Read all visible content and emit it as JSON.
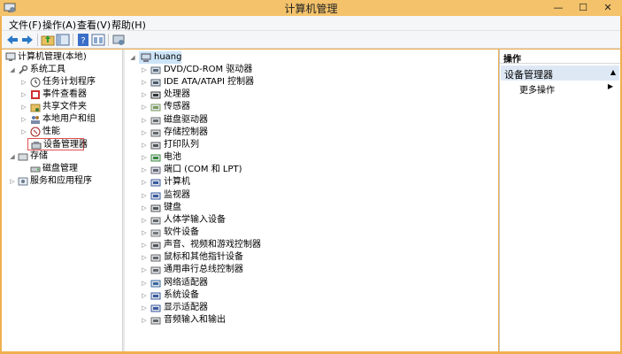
{
  "window": {
    "title": "计算机管理",
    "minimize_glyph": "—",
    "maximize_glyph": "☐",
    "close_glyph": "✕",
    "titlebar_color": "#f3c26a"
  },
  "menu": {
    "items": [
      "文件(F)",
      "操作(A)",
      "查看(V)",
      "帮助(H)"
    ]
  },
  "toolbar": {
    "buttons": [
      "back-icon",
      "forward-icon",
      "up-folder-icon",
      "show-hide-tree-icon",
      "help-icon",
      "properties-icon",
      "device-scan-icon"
    ]
  },
  "left_tree": {
    "items": [
      {
        "label": "计算机管理(本地)",
        "icon": "computer-management-icon",
        "arrow": ""
      },
      {
        "label": "系统工具",
        "icon": "tools-icon",
        "arrow": "◢"
      },
      {
        "label": "任务计划程序",
        "icon": "clock-icon",
        "arrow": "▷"
      },
      {
        "label": "事件查看器",
        "icon": "event-viewer-icon",
        "arrow": "▷"
      },
      {
        "label": "共享文件夹",
        "icon": "shared-folder-icon",
        "arrow": "▷"
      },
      {
        "label": "本地用户和组",
        "icon": "users-icon",
        "arrow": "▷"
      },
      {
        "label": "性能",
        "icon": "performance-icon",
        "arrow": "▷"
      },
      {
        "label": "设备管理器",
        "icon": "device-manager-icon",
        "arrow": ""
      },
      {
        "label": "存储",
        "icon": "storage-icon",
        "arrow": "◢"
      },
      {
        "label": "磁盘管理",
        "icon": "disk-management-icon",
        "arrow": ""
      },
      {
        "label": "服务和应用程序",
        "icon": "services-icon",
        "arrow": "▷"
      }
    ]
  },
  "device_tree": {
    "root": "huang",
    "categories": [
      {
        "label": "DVD/CD-ROM 驱动器",
        "icon": "dvd-icon"
      },
      {
        "label": "IDE ATA/ATAPI 控制器",
        "icon": "ide-controller-icon"
      },
      {
        "label": "处理器",
        "icon": "processor-icon"
      },
      {
        "label": "传感器",
        "icon": "sensor-icon"
      },
      {
        "label": "磁盘驱动器",
        "icon": "disk-drive-icon"
      },
      {
        "label": "存储控制器",
        "icon": "storage-controller-icon"
      },
      {
        "label": "打印队列",
        "icon": "printer-icon"
      },
      {
        "label": "电池",
        "icon": "battery-icon"
      },
      {
        "label": "端口 (COM 和 LPT)",
        "icon": "port-icon"
      },
      {
        "label": "计算机",
        "icon": "computer-icon"
      },
      {
        "label": "监视器",
        "icon": "monitor-icon"
      },
      {
        "label": "键盘",
        "icon": "keyboard-icon"
      },
      {
        "label": "人体学输入设备",
        "icon": "hid-icon"
      },
      {
        "label": "软件设备",
        "icon": "software-device-icon"
      },
      {
        "label": "声音、视频和游戏控制器",
        "icon": "sound-icon"
      },
      {
        "label": "鼠标和其他指针设备",
        "icon": "mouse-icon"
      },
      {
        "label": "通用串行总线控制器",
        "icon": "usb-icon"
      },
      {
        "label": "网络适配器",
        "icon": "network-adapter-icon"
      },
      {
        "label": "系统设备",
        "icon": "system-device-icon"
      },
      {
        "label": "显示适配器",
        "icon": "display-adapter-icon"
      },
      {
        "label": "音频输入和输出",
        "icon": "audio-io-icon"
      }
    ]
  },
  "actions_pane": {
    "header": "操作",
    "section": "设备管理器",
    "collapse_glyph": "▲",
    "items": [
      {
        "label": "更多操作",
        "arrow": "▶"
      }
    ]
  }
}
